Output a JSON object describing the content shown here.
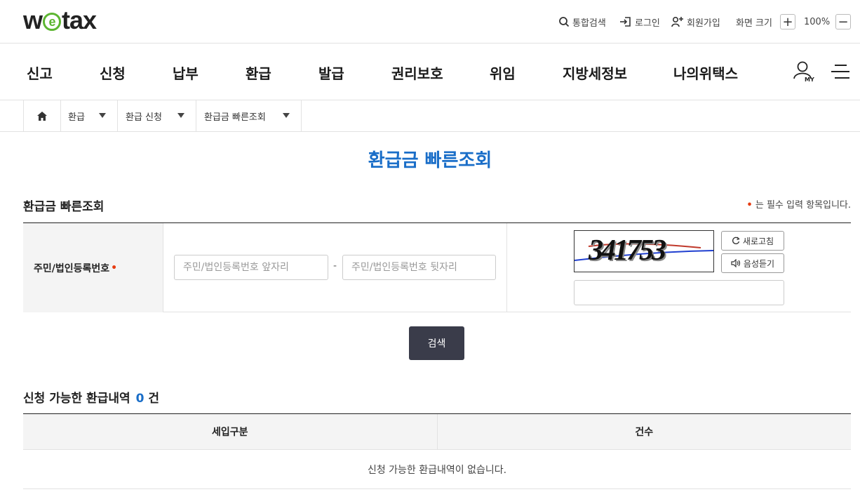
{
  "header": {
    "logo": {
      "pre": "w",
      "mid": "e",
      "post": "tax"
    },
    "integrated_search": "통합검색",
    "login": "로그인",
    "signup": "회원가입",
    "screen_size_label": "화면 크기",
    "zoom_in": "+",
    "zoom_level": "100%",
    "zoom_out": "−"
  },
  "gnb": {
    "items": [
      "신고",
      "신청",
      "납부",
      "환급",
      "발급",
      "권리보호",
      "위임",
      "지방세정보",
      "나의위택스"
    ],
    "my_label": "MY"
  },
  "breadcrumb": {
    "items": [
      "환급",
      "환급 신청",
      "환급금 빠른조회"
    ]
  },
  "page": {
    "title": "환급금 빠른조회",
    "section_title": "환급금 빠른조회",
    "required_note_dot": "•",
    "required_note": " 는 필수 입력 항목입니다."
  },
  "form": {
    "label": "주민/법인등록번호",
    "required_mark": "•",
    "front_placeholder": "주민/법인등록번호 앞자리",
    "separator": "-",
    "back_placeholder": "주민/법인등록번호 뒷자리",
    "captcha_text": "341753",
    "refresh_label": "새로고침",
    "audio_label": "음성듣기",
    "captcha_input_value": ""
  },
  "search_button": "검색",
  "results": {
    "title": "신청 가능한 환급내역",
    "count": "0",
    "count_unit": "건",
    "columns": [
      "세입구분",
      "건수"
    ],
    "empty_message": "신청 가능한 환급내역이 없습니다."
  },
  "colors": {
    "accent_blue": "#1a6ec8",
    "logo_green": "#5cb531",
    "required_red": "#e63c12",
    "button_dark": "#3a3c4a"
  }
}
